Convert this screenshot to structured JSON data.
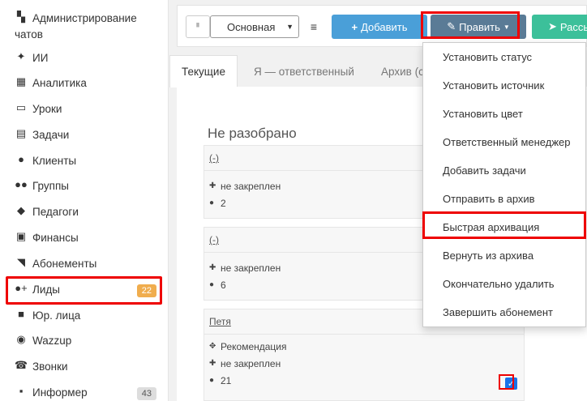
{
  "sidebar": {
    "items": [
      {
        "icon": "chat-icon",
        "label_line1": "Администрирование",
        "label_line2": "чатов"
      },
      {
        "icon": "sparkle-icon",
        "label": "ИИ"
      },
      {
        "icon": "map-icon",
        "label": "Аналитика"
      },
      {
        "icon": "book-icon",
        "label": "Уроки"
      },
      {
        "icon": "clipboard-icon",
        "label": "Задачи"
      },
      {
        "icon": "user-icon",
        "label": "Клиенты"
      },
      {
        "icon": "users-icon",
        "label": "Группы"
      },
      {
        "icon": "graduation-cap-icon",
        "label": "Педагоги"
      },
      {
        "icon": "money-icon",
        "label": "Финансы"
      },
      {
        "icon": "tag-icon",
        "label": "Абонементы"
      },
      {
        "icon": "user-plus-icon",
        "label": "Лиды",
        "badge": "22"
      },
      {
        "icon": "briefcase-icon",
        "label": "Юр. лица"
      },
      {
        "icon": "whatsapp-icon",
        "label": "Wazzup"
      },
      {
        "icon": "phone-icon",
        "label": "Звонки"
      },
      {
        "icon": "info-icon",
        "label": "Информер",
        "badge": "43"
      }
    ]
  },
  "toolbar": {
    "pipeline_value": "Основная",
    "add_label": "Добавить",
    "edit_label": "Править",
    "send_label": "Рассыл"
  },
  "tabs": [
    "Текущие",
    "Я — ответственный",
    "Архив (с"
  ],
  "column_title": "Не разобрано",
  "cards": [
    {
      "head": "(-)",
      "pin_text": "не закреплен",
      "comments": "2"
    },
    {
      "head": "(-)",
      "pin_text": "не закреплен",
      "comments": "6"
    },
    {
      "head": "Петя",
      "source": "Рекомендация",
      "pin_text": "не закреплен",
      "comments": "21",
      "checked": true
    }
  ],
  "dropdown": [
    "Установить статус",
    "Установить источник",
    "Установить цвет",
    "Ответственный менеджер",
    "Добавить задачи",
    "Отправить в архив",
    "Быстрая архивация",
    "Вернуть из архива",
    "Окончательно удалить",
    "Завершить абонемент"
  ],
  "colors": {
    "add": "#4a9fd8",
    "edit": "#5a7b96",
    "send": "#3cc09a",
    "highlight": "#ee0000",
    "badge_orange": "#f0ad4e"
  }
}
